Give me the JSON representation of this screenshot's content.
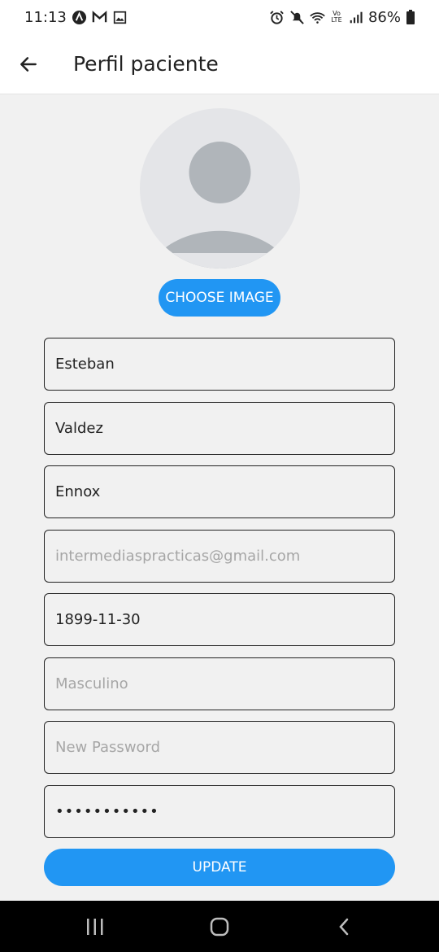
{
  "status_bar": {
    "time": "11:13",
    "battery": "86%",
    "left_icons": [
      "app-a-icon",
      "gmail-icon",
      "gallery-icon"
    ],
    "right_icons": [
      "alarm-icon",
      "mute-icon",
      "wifi-icon",
      "volte-icon",
      "signal-icon",
      "battery-icon"
    ]
  },
  "app_bar": {
    "title": "Perfil paciente"
  },
  "profile": {
    "choose_image_label": "CHOOSE IMAGE"
  },
  "form": {
    "first_name": "Esteban",
    "last_name": "Valdez",
    "second_last_name": "Ennox",
    "email_hint": "intermediaspracticas@gmail.com",
    "birth_date": "1899-11-30",
    "gender_hint": "Masculino",
    "new_password_hint": "New Password",
    "confirm_password": "•••••••••••"
  },
  "update_label": "UPDATE",
  "colors": {
    "accent": "#2196f3",
    "background": "#f1f1f1"
  }
}
